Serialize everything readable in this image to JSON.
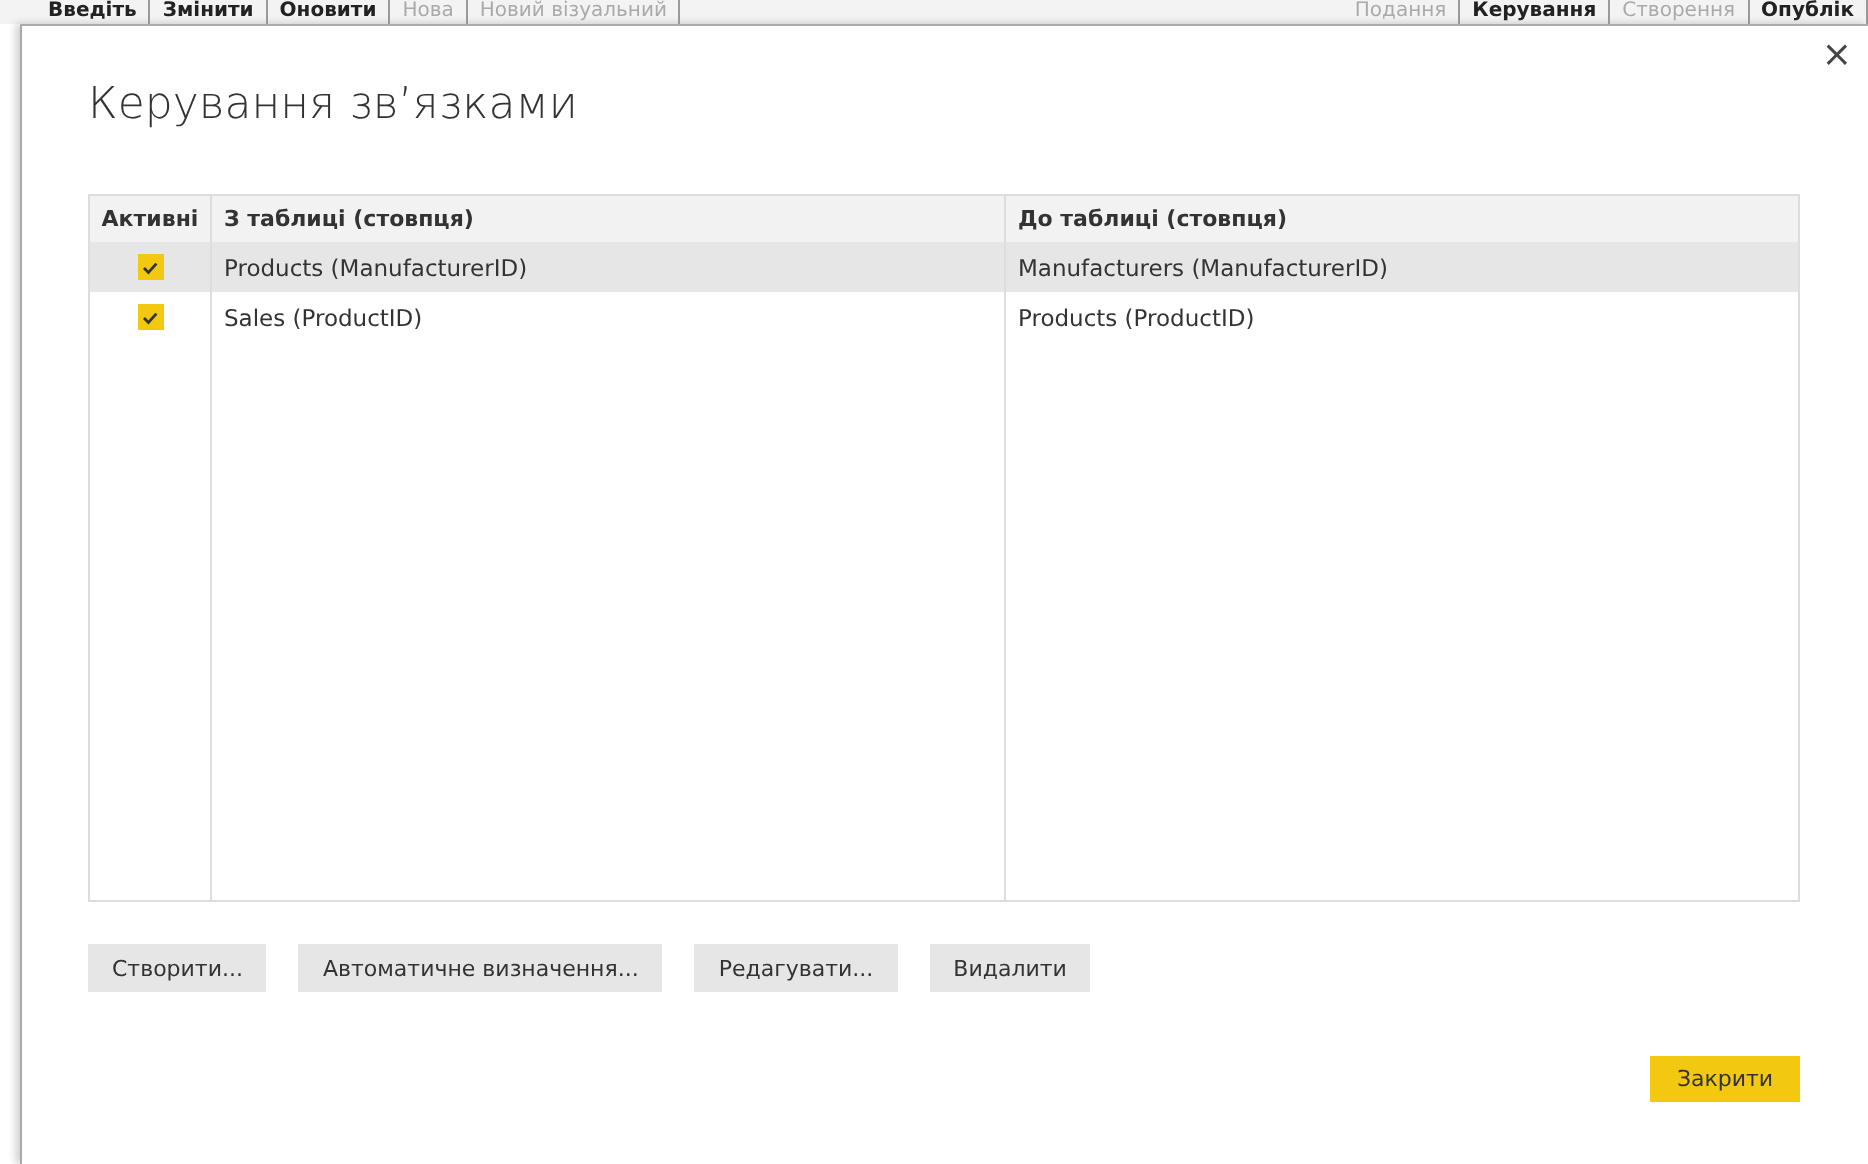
{
  "background_ribbon": {
    "items": [
      {
        "label": "Введіть",
        "disabled": false
      },
      {
        "label": "Змінити",
        "disabled": false
      },
      {
        "label": "Оновити",
        "disabled": false
      },
      {
        "label": "Нова",
        "disabled": true
      },
      {
        "label": "Новий візуальний",
        "disabled": true
      }
    ],
    "right_items": [
      {
        "label": "Подання",
        "disabled": true
      },
      {
        "label": "Керування",
        "disabled": false
      },
      {
        "label": "Створення",
        "disabled": true
      },
      {
        "label": "Опублік",
        "disabled": false
      }
    ]
  },
  "dialog": {
    "title": "Керування зв’язками",
    "close": "×",
    "table": {
      "columns": [
        "Активні",
        "З таблиці (стовпця)",
        "До таблиці (стовпця)"
      ],
      "rows": [
        {
          "active": true,
          "from": "Products (ManufacturerID)",
          "to": "Manufacturers (ManufacturerID)",
          "selected": true
        },
        {
          "active": true,
          "from": "Sales (ProductID)",
          "to": "Products (ProductID)",
          "selected": false
        }
      ]
    },
    "buttons": [
      "Створити...",
      "Автоматичне визначення...",
      "Редагувати...",
      "Видалити"
    ],
    "close_button": "Закрити"
  }
}
